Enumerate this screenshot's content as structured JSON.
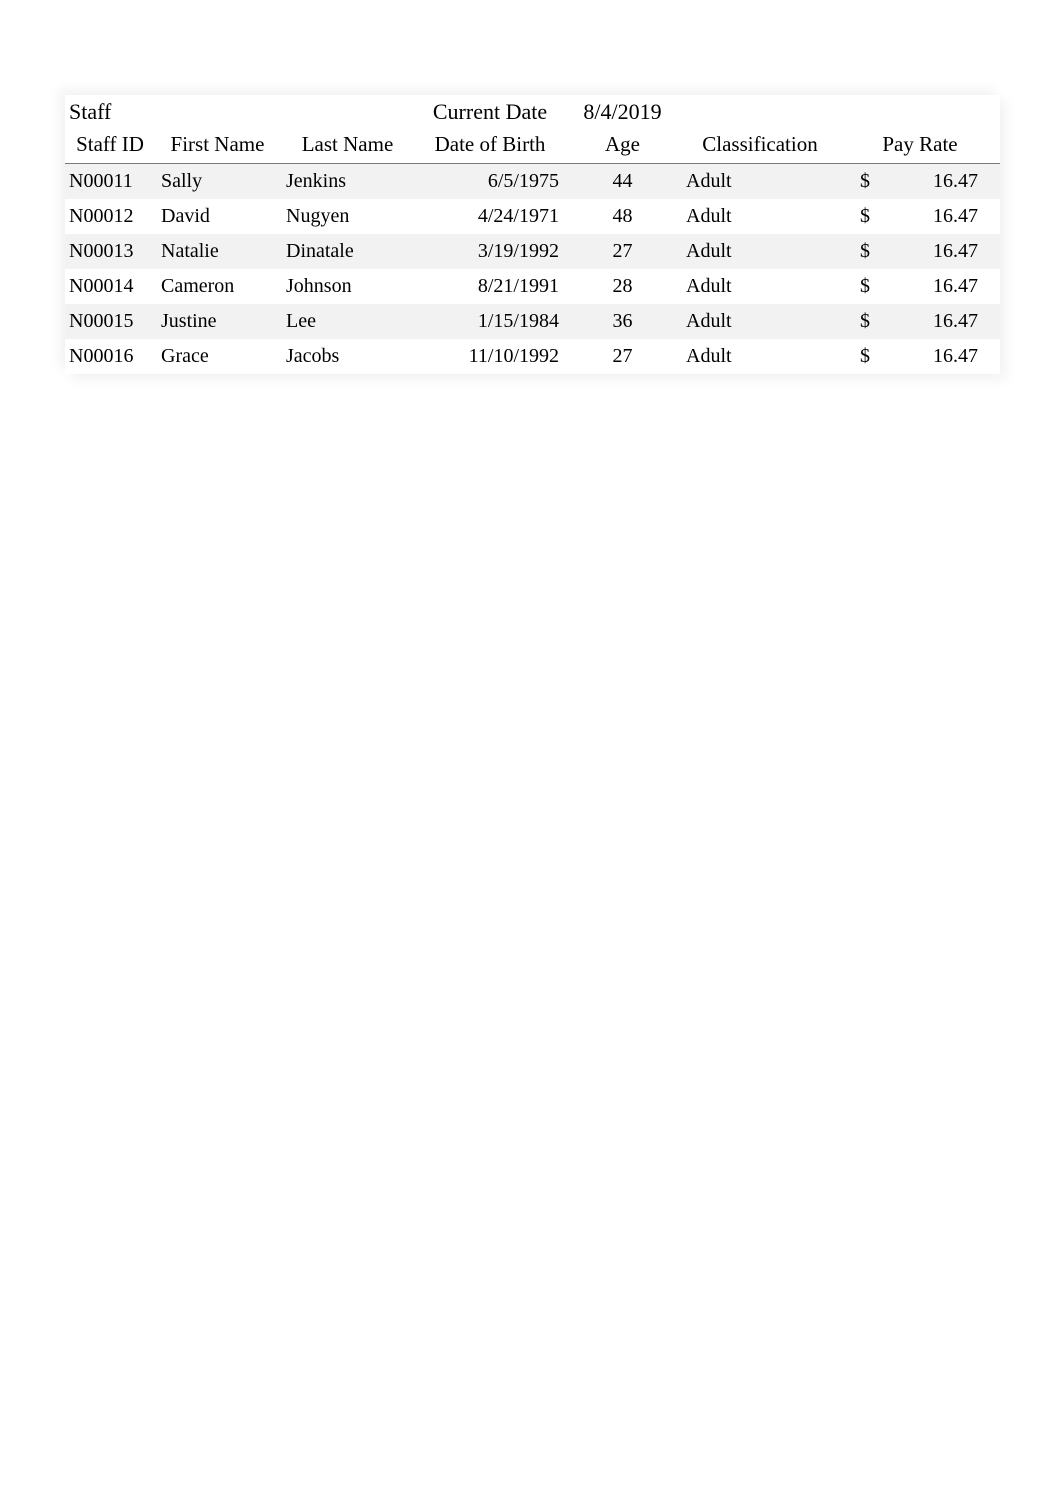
{
  "title": "Staff",
  "current_date_label": "Current Date",
  "current_date": "8/4/2019",
  "columns": {
    "staff_id": "Staff ID",
    "first_name": "First Name",
    "last_name": "Last Name",
    "dob": "Date of Birth",
    "age": "Age",
    "classification": "Classification",
    "pay_rate": "Pay Rate"
  },
  "currency_symbol": "$",
  "rows": [
    {
      "staff_id": "N00011",
      "first_name": "Sally",
      "last_name": "Jenkins",
      "dob": "6/5/1975",
      "age": "44",
      "classification": "Adult",
      "pay_rate": "16.47"
    },
    {
      "staff_id": "N00012",
      "first_name": "David",
      "last_name": "Nugyen",
      "dob": "4/24/1971",
      "age": "48",
      "classification": "Adult",
      "pay_rate": "16.47"
    },
    {
      "staff_id": "N00013",
      "first_name": "Natalie",
      "last_name": "Dinatale",
      "dob": "3/19/1992",
      "age": "27",
      "classification": "Adult",
      "pay_rate": "16.47"
    },
    {
      "staff_id": "N00014",
      "first_name": "Cameron",
      "last_name": "Johnson",
      "dob": "8/21/1991",
      "age": "28",
      "classification": "Adult",
      "pay_rate": "16.47"
    },
    {
      "staff_id": "N00015",
      "first_name": "Justine",
      "last_name": "Lee",
      "dob": "1/15/1984",
      "age": "36",
      "classification": "Adult",
      "pay_rate": "16.47"
    },
    {
      "staff_id": "N00016",
      "first_name": "Grace",
      "last_name": "Jacobs",
      "dob": "11/10/1992",
      "age": "27",
      "classification": "Adult",
      "pay_rate": "16.47"
    }
  ]
}
